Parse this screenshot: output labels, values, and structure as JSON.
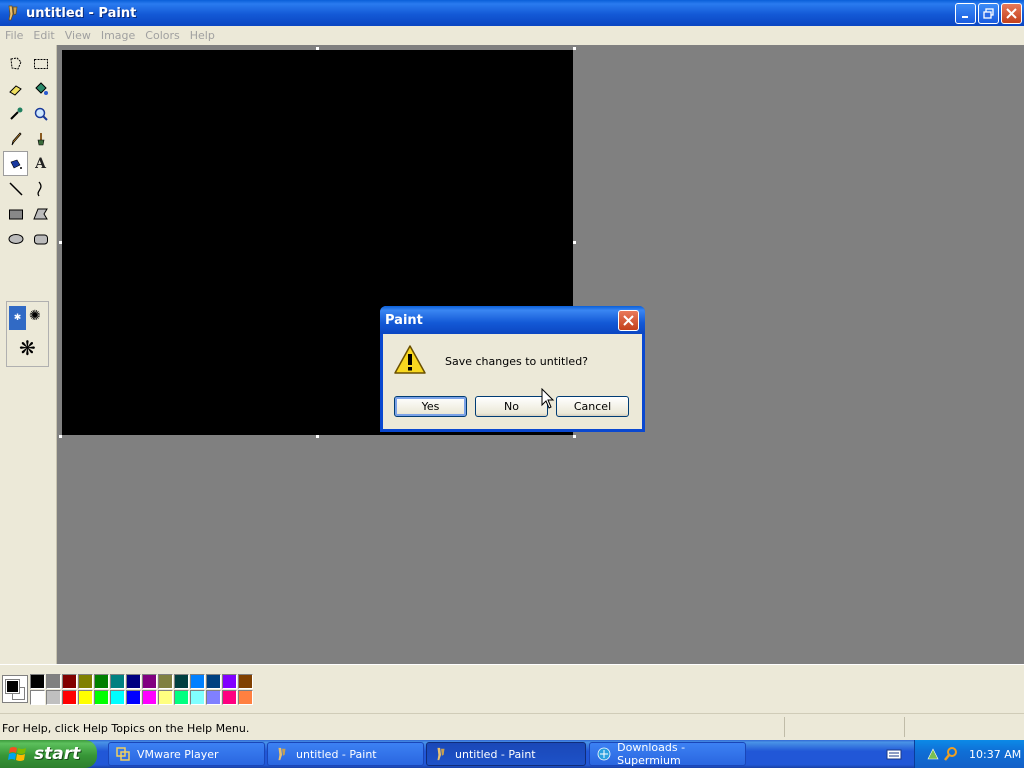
{
  "window": {
    "title": "untitled - Paint",
    "minimize_icon": "minimize-icon",
    "maximize_icon": "restore-icon",
    "close_icon": "close-icon"
  },
  "menu": [
    "File",
    "Edit",
    "View",
    "Image",
    "Colors",
    "Help"
  ],
  "tools": [
    "free-form-select-icon",
    "rect-select-icon",
    "eraser-icon",
    "fill-bucket-icon",
    "color-picker-icon",
    "magnifier-icon",
    "pencil-icon",
    "brush-icon",
    "airbrush-icon",
    "text-icon",
    "line-icon",
    "curve-icon",
    "rectangle-icon",
    "polygon-icon",
    "ellipse-icon",
    "rounded-rect-icon"
  ],
  "active_tool": "airbrush-icon",
  "palette": {
    "foreground": "#000000",
    "background": "#ffffff",
    "top_row": [
      "#000000",
      "#808080",
      "#800000",
      "#808000",
      "#008000",
      "#008080",
      "#000080",
      "#800080",
      "#808040",
      "#004040",
      "#0080ff",
      "#004080",
      "#8000ff",
      "#804000"
    ],
    "bottom_row": [
      "#ffffff",
      "#c0c0c0",
      "#ff0000",
      "#ffff00",
      "#00ff00",
      "#00ffff",
      "#0000ff",
      "#ff00ff",
      "#ffff80",
      "#00ff80",
      "#80ffff",
      "#8080ff",
      "#ff0080",
      "#ff8040"
    ]
  },
  "status": {
    "help_text": "For Help, click Help Topics on the Help Menu."
  },
  "dialog": {
    "title": "Paint",
    "message": "Save changes to untitled?",
    "icon": "warning-icon",
    "buttons": {
      "yes": "Yes",
      "no": "No",
      "cancel": "Cancel"
    }
  },
  "taskbar": {
    "start_label": "start",
    "items": [
      {
        "label": "VMware Player",
        "icon": "vmware-icon"
      },
      {
        "label": "untitled - Paint",
        "icon": "paint-icon"
      },
      {
        "label": "untitled - Paint",
        "icon": "paint-icon",
        "active": true
      },
      {
        "label": "Downloads - Supermium",
        "icon": "browser-icon"
      }
    ],
    "clock": "10:37 AM"
  }
}
